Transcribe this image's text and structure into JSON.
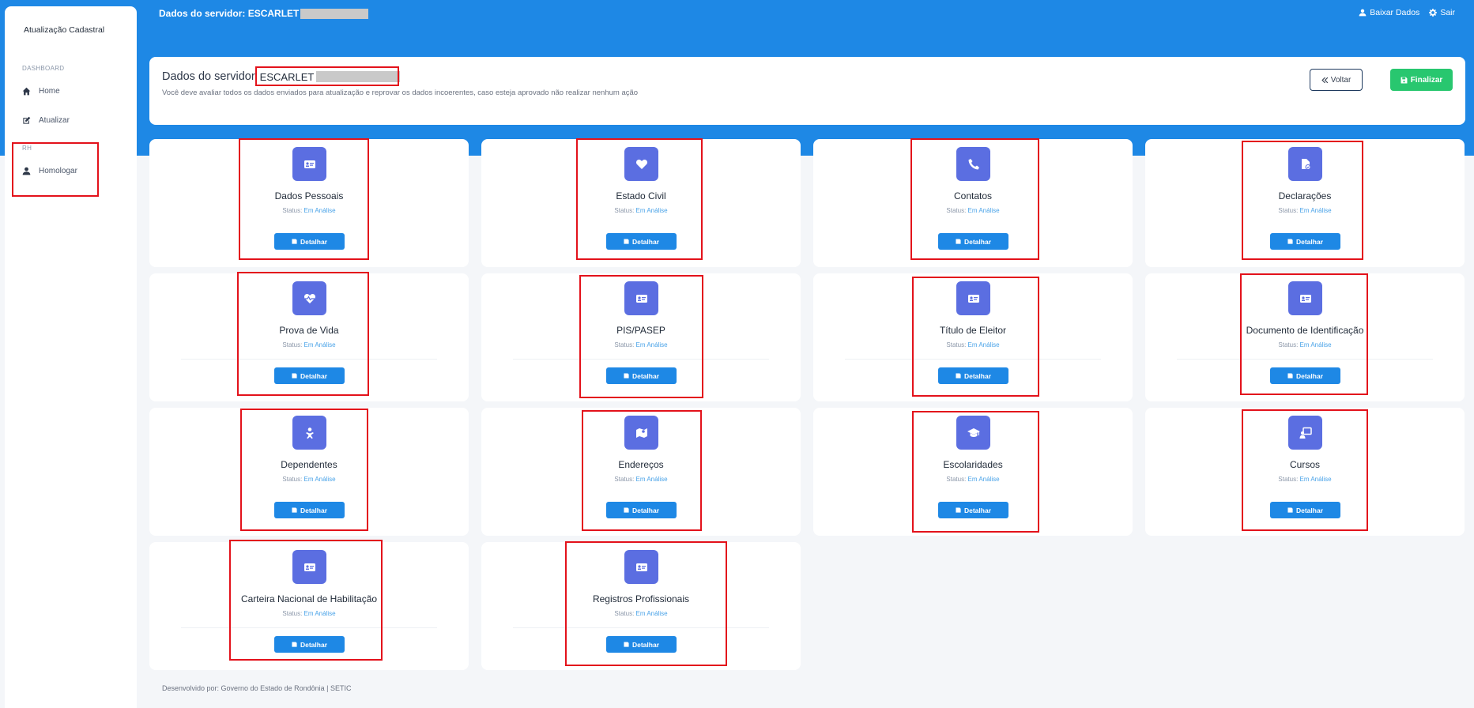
{
  "topbar": {
    "title_prefix": "Dados do servidor: ESCARLET",
    "download_label": "Baixar Dados",
    "logout_label": "Sair"
  },
  "sidebar": {
    "brand": "Atualização Cadastral",
    "section_dashboard": "DASHBOARD",
    "section_rh": "RH",
    "items": [
      {
        "label": "Home",
        "icon": "home-icon"
      },
      {
        "label": "Atualizar",
        "icon": "edit-icon"
      },
      {
        "label": "Homologar",
        "icon": "user-icon"
      }
    ]
  },
  "server_card": {
    "title": "Dados do servidor",
    "name": "ESCARLET",
    "description": "Você deve avaliar todos os dados enviados para atualização e reprovar os dados incoerentes, caso esteja aprovado não realizar nenhum ação",
    "back_label": "Voltar",
    "finish_label": "Finalizar"
  },
  "cards": [
    {
      "title": "Dados Pessoais",
      "status_label": "Status:",
      "status": "Em Análise",
      "button": "Detalhar",
      "icon": "id-card-icon"
    },
    {
      "title": "Estado Civil",
      "status_label": "Status:",
      "status": "Em Análise",
      "button": "Detalhar",
      "icon": "heart-icon"
    },
    {
      "title": "Contatos",
      "status_label": "Status:",
      "status": "Em Análise",
      "button": "Detalhar",
      "icon": "phone-icon"
    },
    {
      "title": "Declarações",
      "status_label": "Status:",
      "status": "Em Análise",
      "button": "Detalhar",
      "icon": "file-check-icon"
    },
    {
      "title": "Prova de Vida",
      "status_label": "Status:",
      "status": "Em Análise",
      "button": "Detalhar",
      "icon": "heartbeat-icon"
    },
    {
      "title": "PIS/PASEP",
      "status_label": "Status:",
      "status": "Em Análise",
      "button": "Detalhar",
      "icon": "id-card-icon"
    },
    {
      "title": "Título de Eleitor",
      "status_label": "Status:",
      "status": "Em Análise",
      "button": "Detalhar",
      "icon": "id-card-icon"
    },
    {
      "title": "Documento de Identificação",
      "status_label": "Status:",
      "status": "Em Análise",
      "button": "Detalhar",
      "icon": "id-card-icon"
    },
    {
      "title": "Dependentes",
      "status_label": "Status:",
      "status": "Em Análise",
      "button": "Detalhar",
      "icon": "baby-icon"
    },
    {
      "title": "Endereços",
      "status_label": "Status:",
      "status": "Em Análise",
      "button": "Detalhar",
      "icon": "map-icon"
    },
    {
      "title": "Escolaridades",
      "status_label": "Status:",
      "status": "Em Análise",
      "button": "Detalhar",
      "icon": "graduation-cap-icon"
    },
    {
      "title": "Cursos",
      "status_label": "Status:",
      "status": "Em Análise",
      "button": "Detalhar",
      "icon": "teacher-icon"
    },
    {
      "title": "Carteira Nacional de Habilitação",
      "status_label": "Status:",
      "status": "Em Análise",
      "button": "Detalhar",
      "icon": "id-card-icon"
    },
    {
      "title": "Registros Profissionais",
      "status_label": "Status:",
      "status": "Em Análise",
      "button": "Detalhar",
      "icon": "id-card-icon"
    }
  ],
  "footer": "Desenvolvido por: Governo do Estado de Rondônia | SETIC",
  "colors": {
    "primary": "#1e88e5",
    "success": "#28c76f",
    "icon_bg": "#5b6ee1",
    "highlight": "#e3121b"
  }
}
